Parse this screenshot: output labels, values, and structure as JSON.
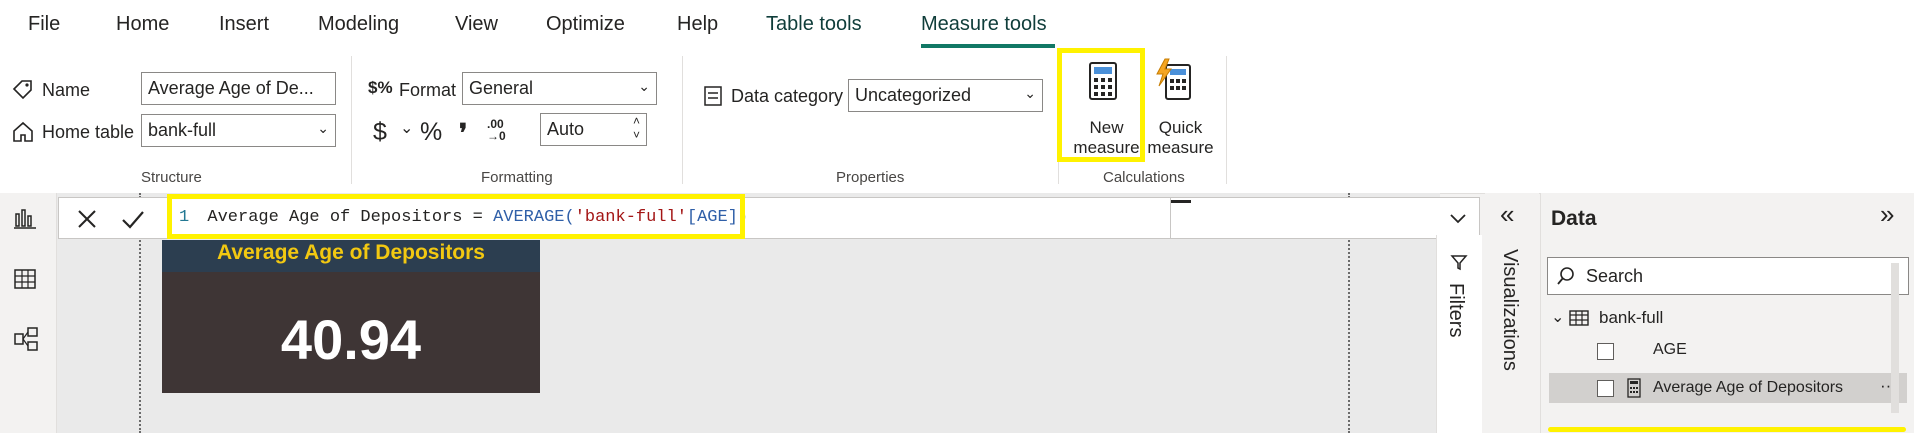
{
  "menu": {
    "file": "File",
    "home": "Home",
    "insert": "Insert",
    "modeling": "Modeling",
    "view": "View",
    "optimize": "Optimize",
    "help": "Help",
    "table_tools": "Table tools",
    "measure_tools": "Measure tools"
  },
  "structure": {
    "name_label": "Name",
    "name_value": "Average Age of De...",
    "home_table_label": "Home table",
    "home_table_value": "bank-full",
    "group_label": "Structure"
  },
  "formatting": {
    "format_label": "Format",
    "format_value": "General",
    "currency_symbol": "$",
    "percent_symbol": "%",
    "comma_symbol": "❜",
    "decimal_symbol": ".00",
    "decimal_sub": "→0",
    "decimals_value": "Auto",
    "group_label": "Formatting"
  },
  "properties": {
    "data_category_label": "Data category",
    "data_category_value": "Uncategorized",
    "group_label": "Properties"
  },
  "calculations": {
    "new_measure_line1": "New",
    "new_measure_line2": "measure",
    "quick_measure_line1": "Quick",
    "quick_measure_line2": "measure",
    "group_label": "Calculations"
  },
  "formula": {
    "line_number": "1",
    "measure_name": "Average Age of Depositors",
    "equals": "=",
    "function": "AVERAGE(",
    "table_ref": "'bank-full'",
    "column_ref": "[AGE]",
    "close": ")"
  },
  "card": {
    "title": "Average Age of Depositors",
    "value": "40.94"
  },
  "panes": {
    "filters_label": "Filters",
    "visualizations_label": "Visualizations",
    "data_title": "Data",
    "search_placeholder": "Search"
  },
  "data_fields": {
    "table_name": "bank-full",
    "fields": [
      {
        "label": "AGE"
      },
      {
        "label": "Average Age of Depositors",
        "more": "···"
      }
    ]
  },
  "colors": {
    "accent": "#117865",
    "highlight": "#fff200",
    "card_bg": "#3e3535",
    "card_title": "#f2c811"
  }
}
